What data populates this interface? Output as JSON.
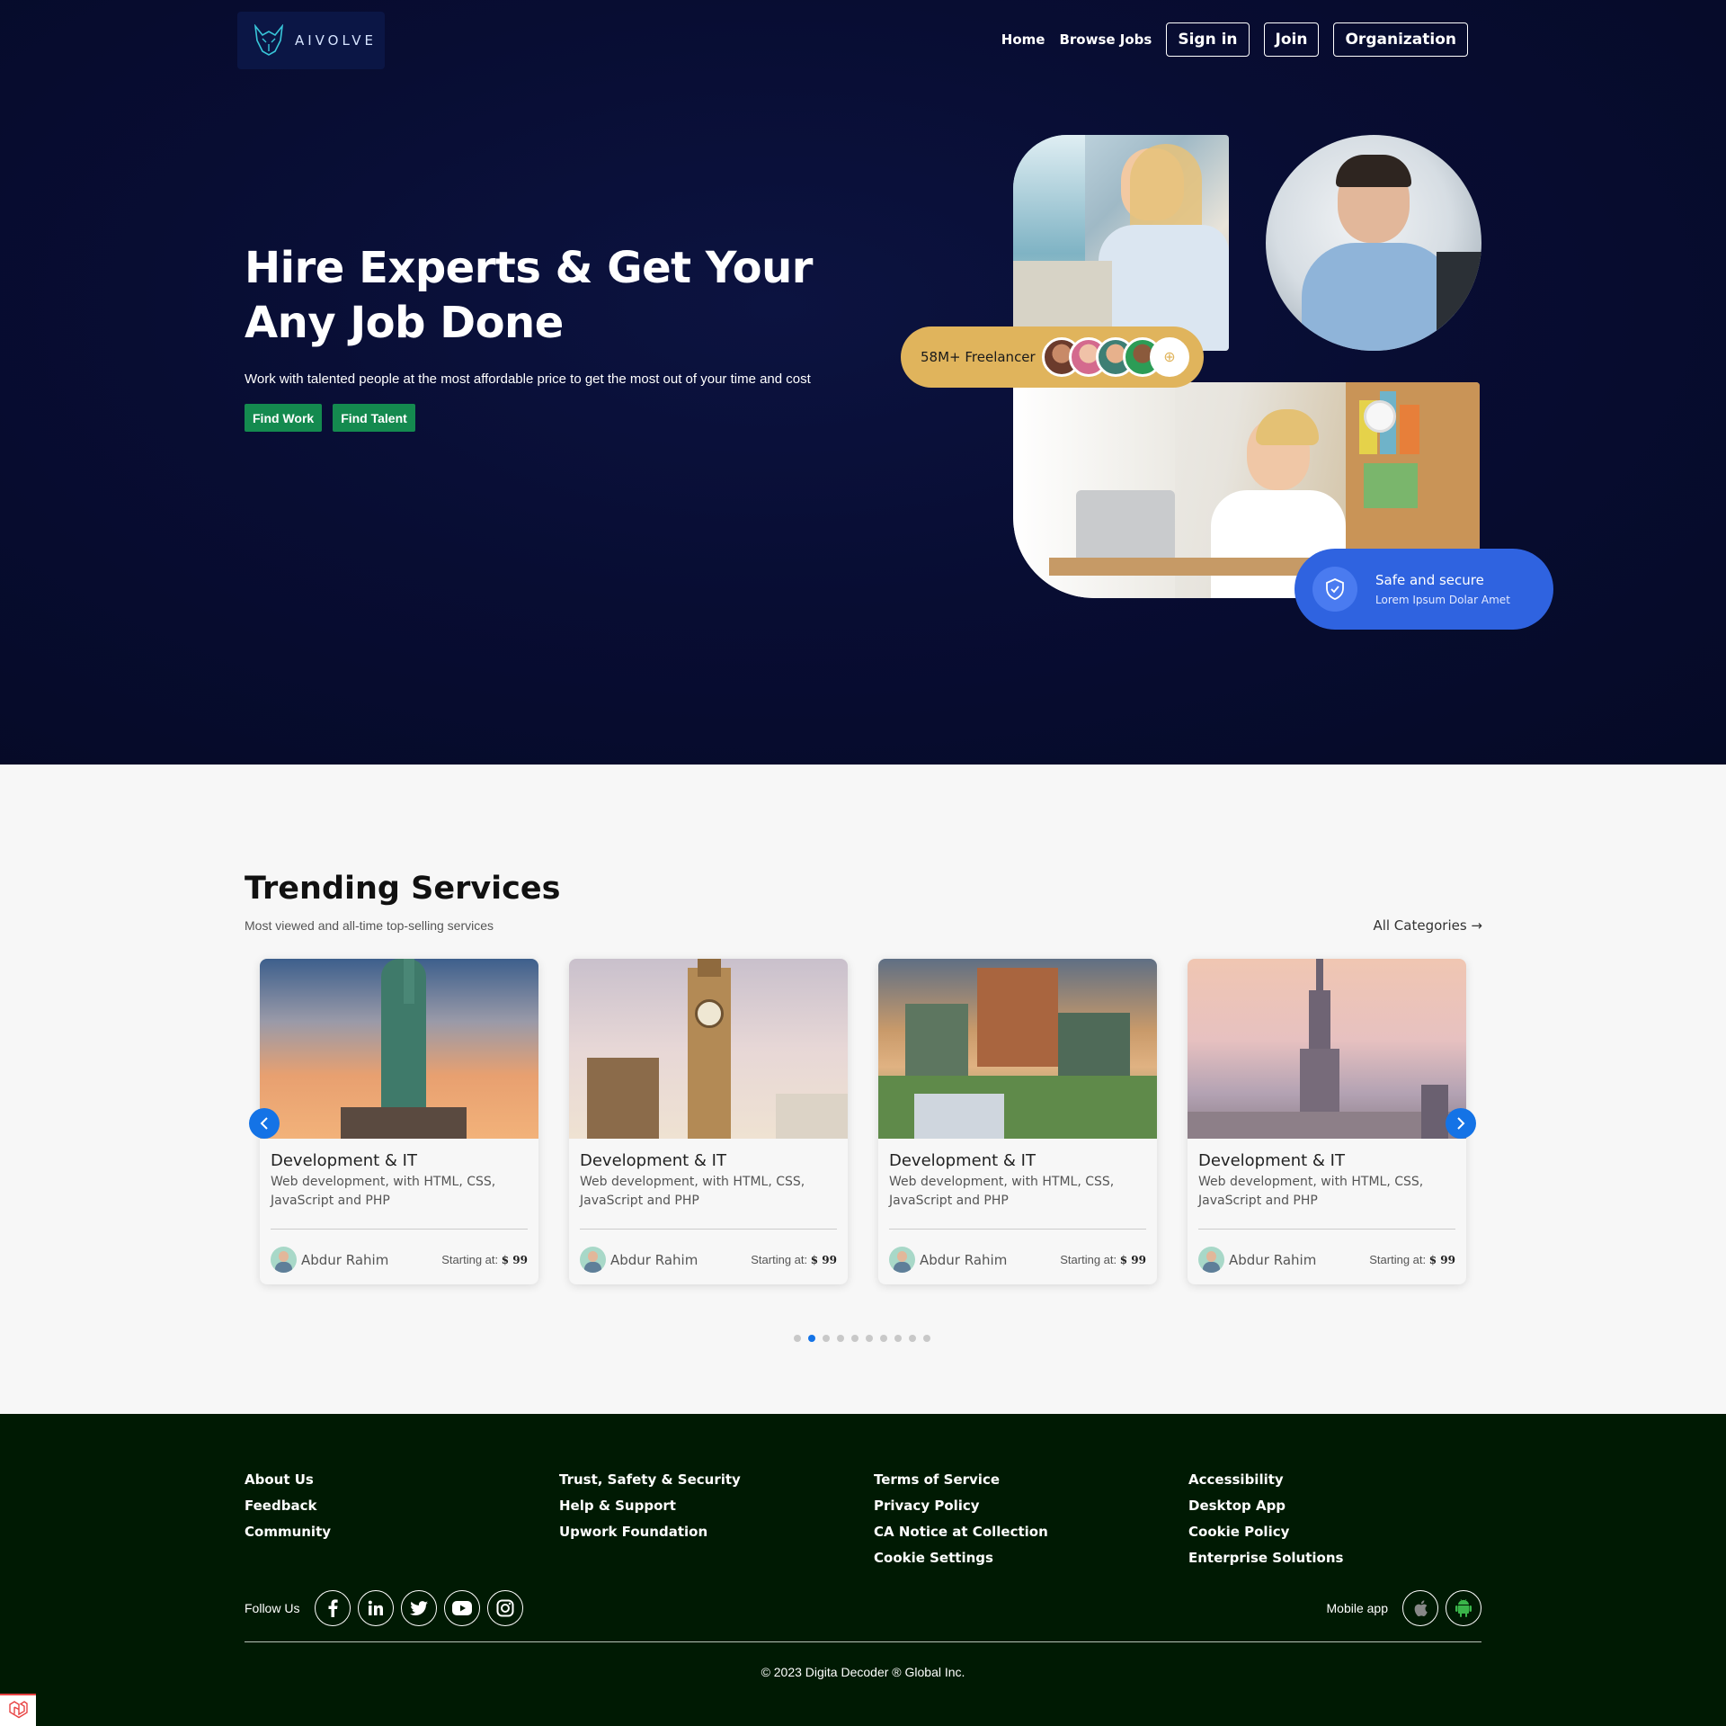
{
  "header": {
    "logo_text": "AIVOLVE",
    "nav": [
      "Home",
      "Browse Jobs"
    ],
    "buttons": [
      "Sign in",
      "Join",
      "Organization"
    ]
  },
  "hero": {
    "title": "Hire Experts & Get Your Any Job Done",
    "subtitle": "Work with talented people at the most affordable price to get the most out of your time and cost",
    "buttons": [
      "Find Work",
      "Find Talent"
    ],
    "freelancer_badge": "58M+ Freelancer",
    "secure_title": "Safe and secure",
    "secure_subtitle": "Lorem Ipsum Dolar Amet"
  },
  "trending": {
    "title": "Trending Services",
    "subtitle": "Most viewed and all-time top-selling services",
    "all_categories": "All Categories →",
    "cards": [
      {
        "image": "statue-of-liberty",
        "title": "Development & IT",
        "desc": "Web development, with HTML, CSS, JavaScript and PHP",
        "author": "Abdur Rahim",
        "price_label": "Starting at:",
        "price": "$ 99"
      },
      {
        "image": "big-ben",
        "title": "Development & IT",
        "desc": "Web development, with HTML, CSS, JavaScript and PHP",
        "author": "Abdur Rahim",
        "price_label": "Starting at:",
        "price": "$ 99"
      },
      {
        "image": "chateau-frontenac",
        "title": "Development & IT",
        "desc": "Web development, with HTML, CSS, JavaScript and PHP",
        "author": "Abdur Rahim",
        "price_label": "Starting at:",
        "price": "$ 99"
      },
      {
        "image": "burj-khalifa",
        "title": "Development & IT",
        "desc": "Web development, with HTML, CSS, JavaScript and PHP",
        "author": "Abdur Rahim",
        "price_label": "Starting at:",
        "price": "$ 99"
      }
    ],
    "pagination": {
      "total": 10,
      "active": 2
    }
  },
  "footer": {
    "columns": [
      [
        "About Us",
        "Feedback",
        "Community"
      ],
      [
        "Trust, Safety & Security",
        "Help & Support",
        "Upwork Foundation"
      ],
      [
        "Terms of Service",
        "Privacy Policy",
        "CA Notice at Collection",
        "Cookie Settings"
      ],
      [
        "Accessibility",
        "Desktop App",
        "Cookie Policy",
        "Enterprise Solutions"
      ]
    ],
    "follow_label": "Follow Us",
    "social": [
      "facebook-icon",
      "linkedin-icon",
      "twitter-icon",
      "youtube-icon",
      "instagram-icon"
    ],
    "mobile_label": "Mobile app",
    "apps": [
      "apple-icon",
      "android-icon"
    ],
    "copyright": "© 2023 Digita Decoder ® Global Inc."
  },
  "colors": {
    "hero_bg": "#080d33",
    "green_button": "#148a4f",
    "badge_gold": "#e0b45c",
    "secure_blue": "#2f63e0",
    "accent_blue": "#1473e6",
    "footer_bg": "#001a03"
  }
}
